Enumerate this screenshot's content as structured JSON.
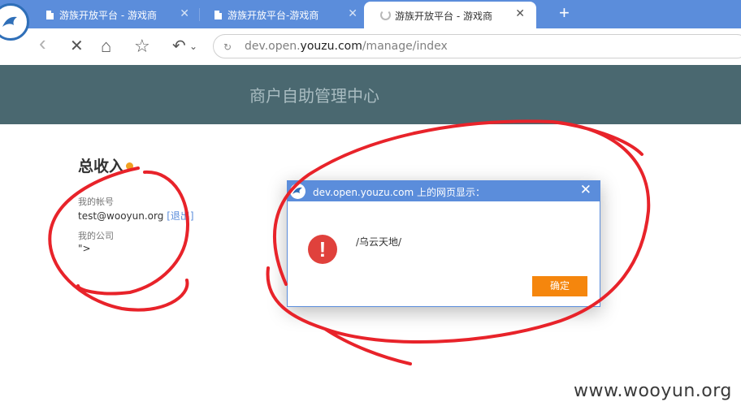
{
  "browser": {
    "tabs": [
      {
        "title": "游族开放平台 - 游戏商",
        "close": "✕"
      },
      {
        "title": "游族开放平台-游戏商",
        "close": "✕"
      },
      {
        "title": "游族开放平台 - 游戏商",
        "close": "✕",
        "active": true,
        "loading": true
      }
    ],
    "new_tab": "+",
    "nav": {
      "back": "‹",
      "stop": "✕",
      "home": "⌂",
      "favorite": "☆",
      "undo": "↶",
      "undo_menu": "⌄"
    },
    "address": {
      "host_prefix": "dev.open.",
      "host_domain": "youzu.com",
      "path": "/manage/index"
    }
  },
  "page": {
    "header_title": "商户自助管理中心",
    "income_heading": "总收入",
    "account_label": "我的帐号",
    "account_value": "test@wooyun.org",
    "logout_link": "[退出]",
    "company_label": "我的公司",
    "company_value": "\">"
  },
  "dialog": {
    "title": "dev.open.youzu.com 上的网页显示：",
    "close": "✕",
    "message": "/乌云天地/",
    "ok_label": "确定",
    "error_glyph": "!"
  },
  "watermark": "www.wooyun.org",
  "colors": {
    "tab_strip": "#5b8ddb",
    "header": "#4a6870",
    "ok_button": "#f5860d",
    "error": "#e0413c",
    "annotation_ink": "#e8232a"
  }
}
